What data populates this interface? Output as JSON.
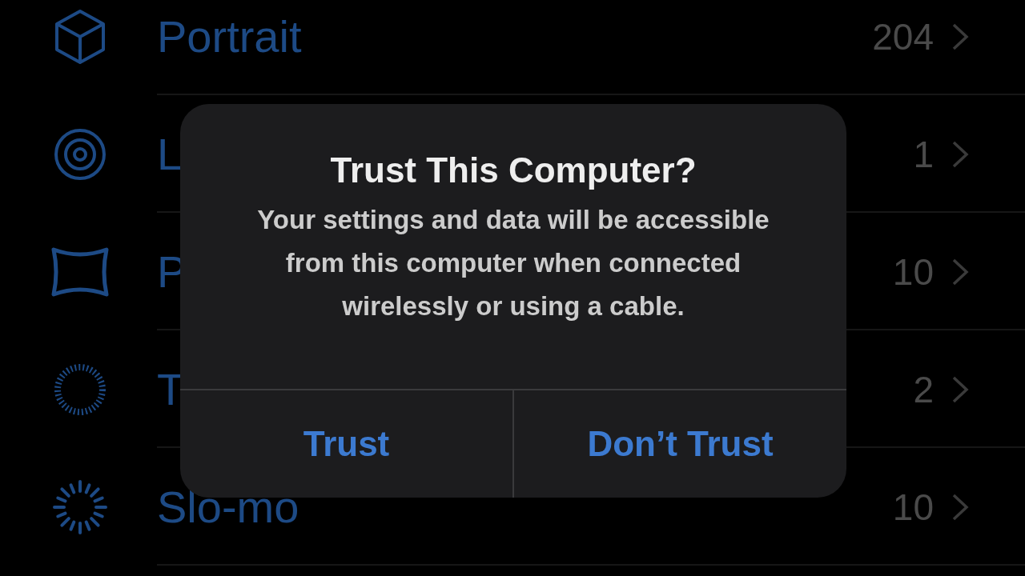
{
  "albums": [
    {
      "label": "Portrait",
      "count": "204"
    },
    {
      "label": "L",
      "count": "1"
    },
    {
      "label": "P",
      "count": "10"
    },
    {
      "label": "T",
      "count": "2"
    },
    {
      "label": "Slo-mo",
      "count": "10"
    }
  ],
  "alert": {
    "title": "Trust This Computer?",
    "message": "Your settings and data will be accessible from this computer when connected wirelessly or using a cable.",
    "buttons": [
      "Trust",
      "Don’t Trust"
    ]
  }
}
